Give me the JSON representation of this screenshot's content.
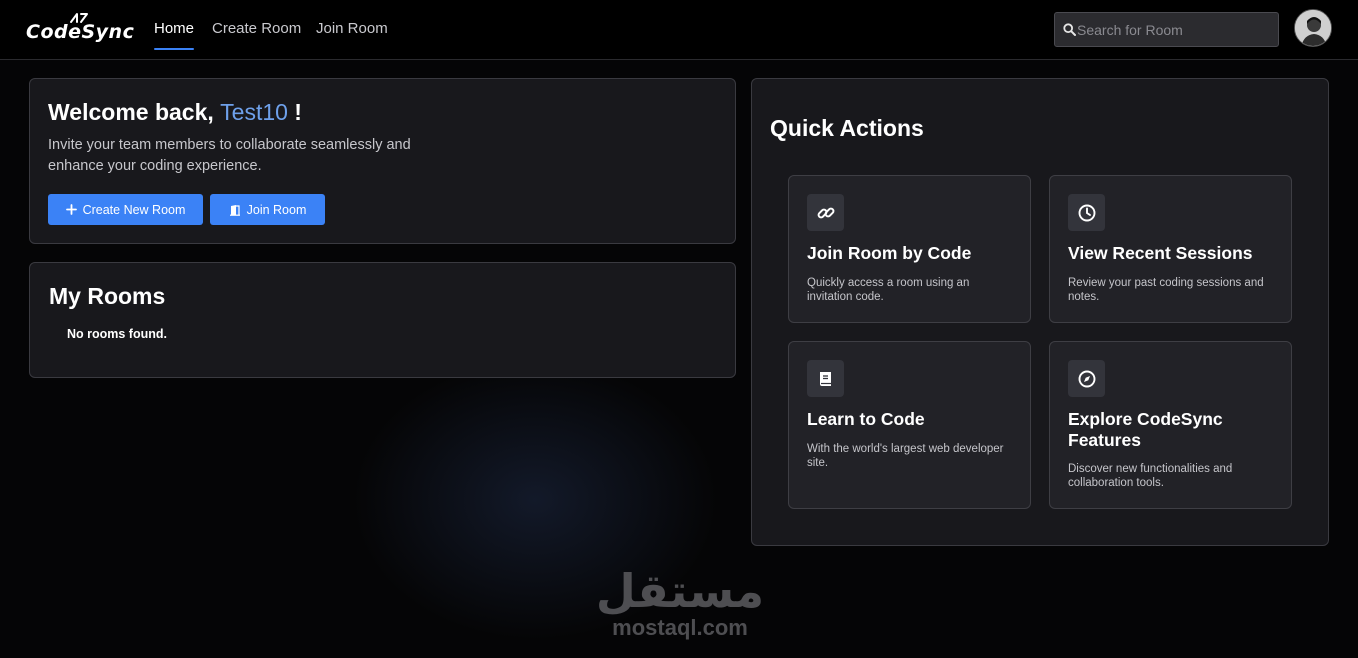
{
  "navbar": {
    "logo_text": "CodeSync",
    "links": [
      {
        "label": "Home",
        "active": true
      },
      {
        "label": "Create Room",
        "active": false
      },
      {
        "label": "Join Room",
        "active": false
      }
    ],
    "search": {
      "placeholder": "Search for Room",
      "value": ""
    },
    "accent_color": "#3b82f6"
  },
  "welcome": {
    "greeting": "Welcome back, ",
    "username": "Test10",
    "exclaim": " !",
    "description": "Invite your team members to collaborate seamlessly and enhance your coding experience.",
    "create_button": "Create New Room",
    "join_button": "Join Room"
  },
  "my_rooms": {
    "title": "My Rooms",
    "empty_message": "No rooms found."
  },
  "quick_actions": {
    "title": "Quick Actions",
    "tiles": [
      {
        "icon": "link-icon",
        "title": "Join Room by Code",
        "description": "Quickly access a room using an invitation code."
      },
      {
        "icon": "clock-icon",
        "title": "View Recent Sessions",
        "description": "Review your past coding sessions and notes."
      },
      {
        "icon": "book-icon",
        "title": "Learn to Code",
        "description": "With the world's largest web developer site."
      },
      {
        "icon": "compass-icon",
        "title": "Explore CodeSync Features",
        "description": "Discover new functionalities and collaboration tools."
      }
    ]
  },
  "watermark": {
    "arabic": "مستقل",
    "latin": "mostaql.com"
  }
}
